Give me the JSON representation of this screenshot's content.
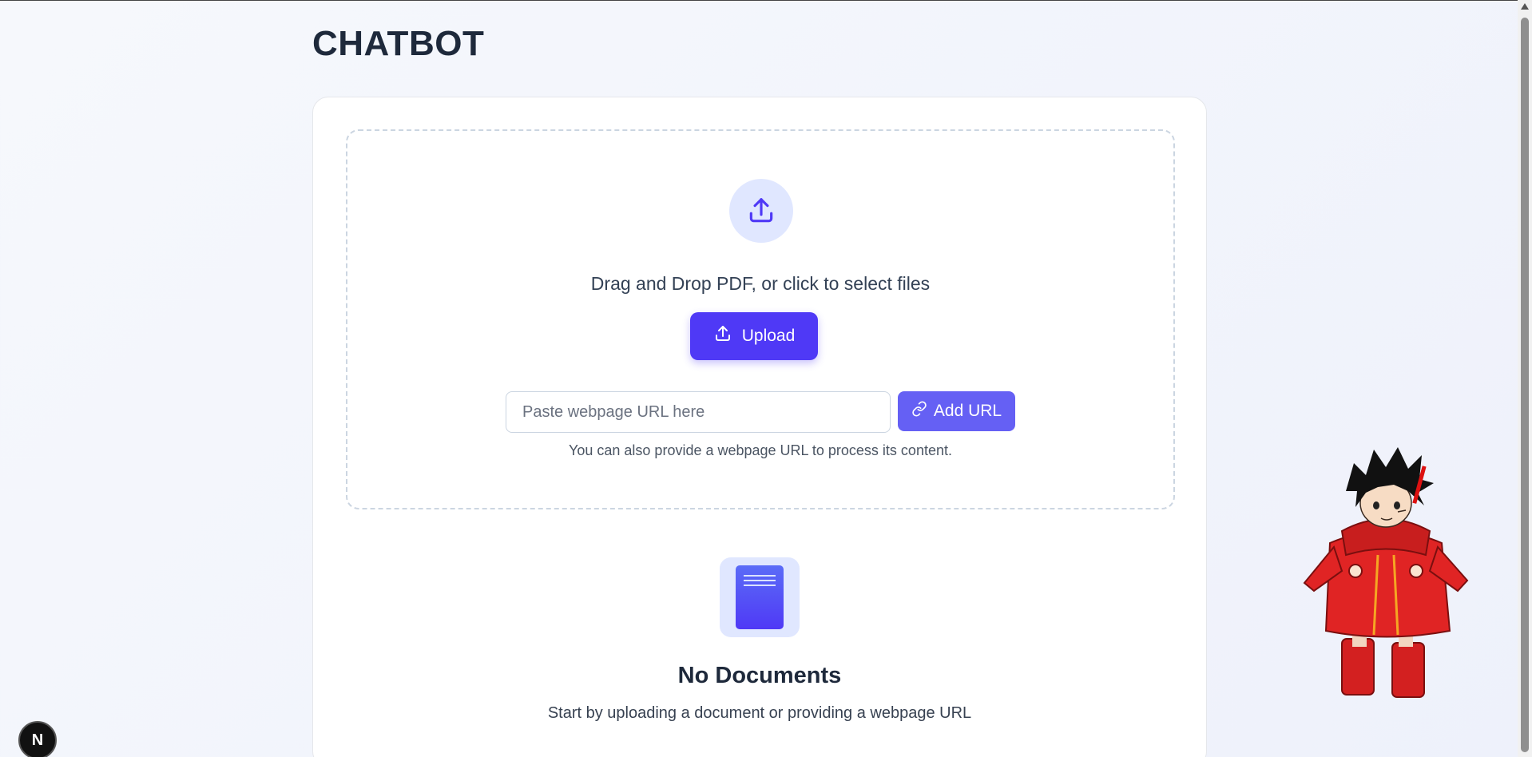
{
  "page": {
    "title": "CHATBOT"
  },
  "upload": {
    "icon": "upload-icon",
    "drop_text": "Drag and Drop PDF, or click to select files",
    "button_label": "Upload"
  },
  "url": {
    "placeholder": "Paste webpage URL here",
    "value": "",
    "button_label": "Add URL",
    "hint": "You can also provide a webpage URL to process its content."
  },
  "empty_state": {
    "icon": "document-icon",
    "title": "No Documents",
    "subtitle": "Start by uploading a document or providing a webpage URL"
  },
  "dev_badge": {
    "label": "N"
  },
  "colors": {
    "primary": "#4f39f6",
    "secondary_button": "#6560f4",
    "icon_bg": "#e0e7ff",
    "title": "#1e293b"
  }
}
